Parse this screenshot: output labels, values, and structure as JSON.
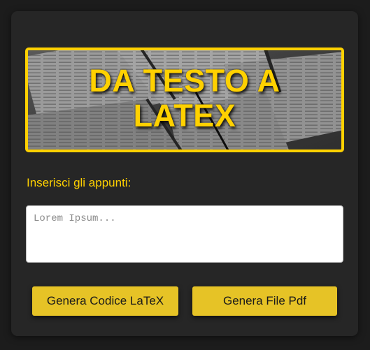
{
  "banner": {
    "title_line1": "DA TESTO A",
    "title_line2": "LATEX"
  },
  "notes": {
    "label": "Inserisci gli appunti:",
    "placeholder": "Lorem Ipsum...",
    "value": ""
  },
  "actions": {
    "latex_label": "Genera Codice LaTeX",
    "pdf_label": "Genera File Pdf"
  },
  "colors": {
    "accent": "#ffd100",
    "button": "#e6c326",
    "card": "#262626",
    "background": "#1c1c1c"
  }
}
